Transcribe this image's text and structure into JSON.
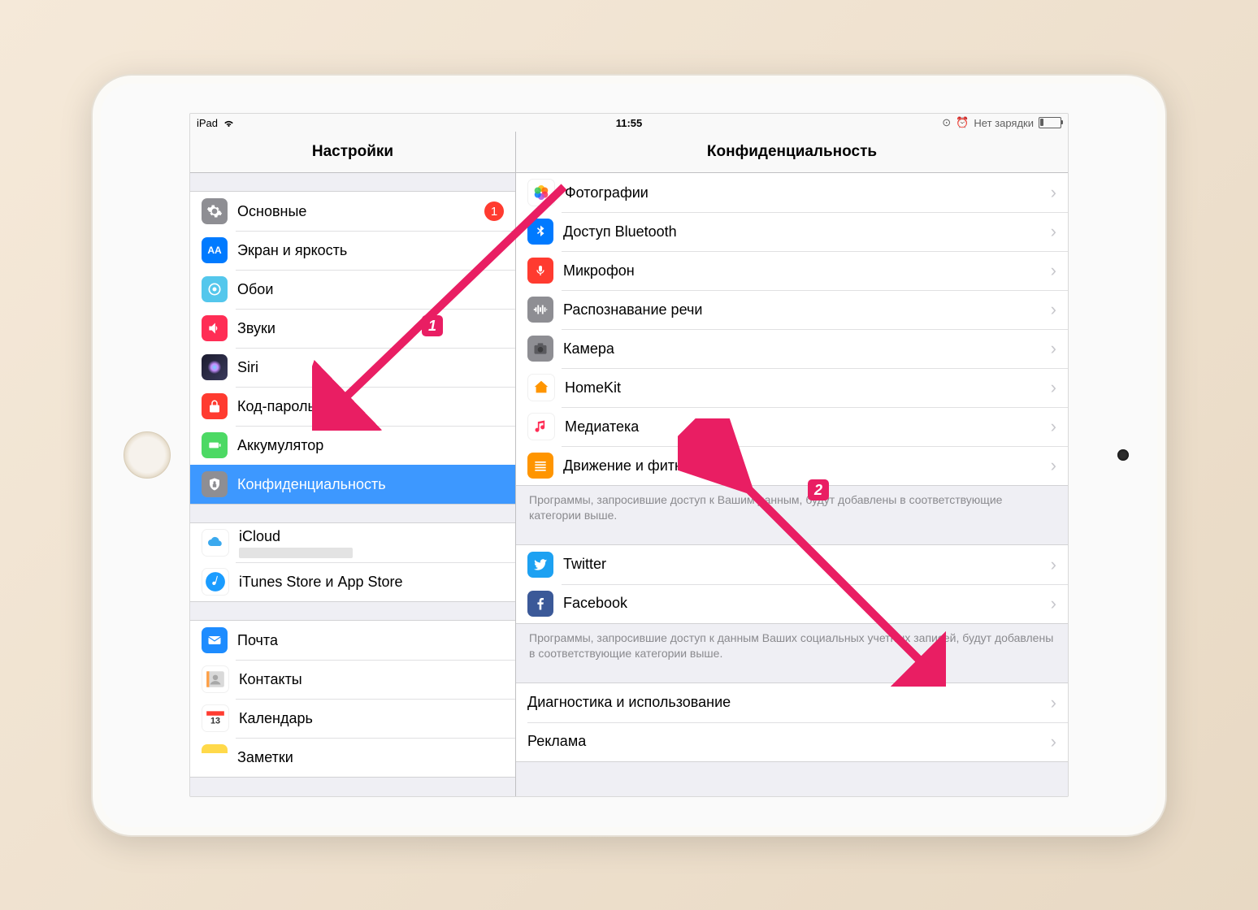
{
  "statusbar": {
    "device": "iPad",
    "time": "11:55",
    "battery": "Нет зарядки"
  },
  "left": {
    "title": "Настройки",
    "g1": [
      {
        "label": "Основные",
        "icon": "ic-general",
        "badge": "1"
      },
      {
        "label": "Экран и яркость",
        "icon": "ic-display"
      },
      {
        "label": "Обои",
        "icon": "ic-wall"
      },
      {
        "label": "Звуки",
        "icon": "ic-sound"
      },
      {
        "label": "Siri",
        "icon": "ic-siri"
      },
      {
        "label": "Код-пароль",
        "icon": "ic-pass"
      },
      {
        "label": "Аккумулятор",
        "icon": "ic-batt"
      },
      {
        "label": "Конфиденциальность",
        "icon": "ic-priv",
        "selected": true
      }
    ],
    "g2": [
      {
        "label": "iCloud",
        "icon": "ic-cloud",
        "redacted": true
      },
      {
        "label": "iTunes Store и App Store",
        "icon": "ic-itunes"
      }
    ],
    "g3": [
      {
        "label": "Почта",
        "icon": "ic-mail"
      },
      {
        "label": "Контакты",
        "icon": "ic-contacts"
      },
      {
        "label": "Календарь",
        "icon": "ic-cal"
      },
      {
        "label": "Заметки",
        "icon": "ic-notes"
      }
    ]
  },
  "right": {
    "title": "Конфиденциальность",
    "g1": [
      {
        "label": "Фотографии",
        "icon": "ic-photos"
      },
      {
        "label": "Доступ Bluetooth",
        "icon": "ic-bt"
      },
      {
        "label": "Микрофон",
        "icon": "ic-mic"
      },
      {
        "label": "Распознавание речи",
        "icon": "ic-speech"
      },
      {
        "label": "Камера",
        "icon": "ic-camera"
      },
      {
        "label": "HomeKit",
        "icon": "ic-homekit"
      },
      {
        "label": "Медиатека",
        "icon": "ic-media"
      },
      {
        "label": "Движение и фитнес",
        "icon": "ic-motion"
      }
    ],
    "foot1": "Программы, запросившие доступ к Вашим данным, будут добавлены в соответствующие категории выше.",
    "g2": [
      {
        "label": "Twitter",
        "icon": "ic-twitter"
      },
      {
        "label": "Facebook",
        "icon": "ic-facebook"
      }
    ],
    "foot2": "Программы, запросившие доступ к данным Ваших социальных учетных записей, будут добавлены в соответствующие категории выше.",
    "g3": [
      {
        "label": "Диагностика и использование"
      },
      {
        "label": "Реклама"
      }
    ]
  },
  "annotations": {
    "n1": "1",
    "n2": "2"
  }
}
